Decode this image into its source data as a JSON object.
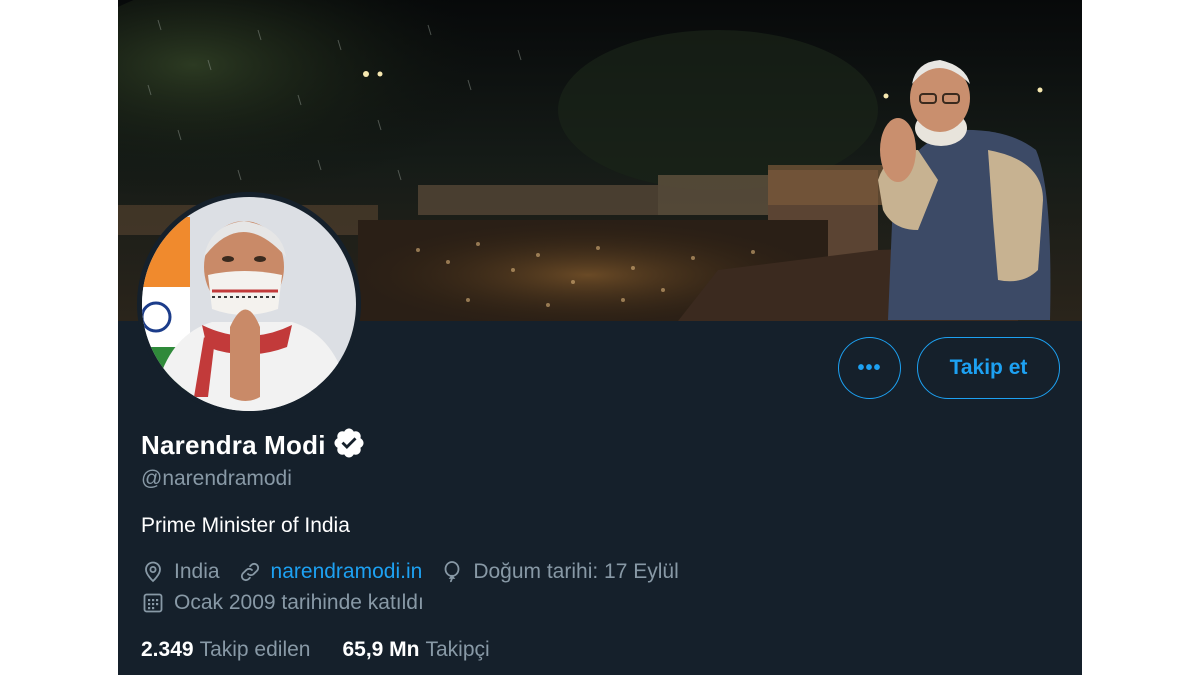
{
  "profile": {
    "display_name": "Narendra Modi",
    "handle": "@narendramodi",
    "bio": "Prime Minister of India",
    "verified": true,
    "location": "India",
    "website": "narendramodi.in",
    "birthday": "Doğum tarihi: 17 Eylül",
    "joined": "Ocak 2009 tarihinde katıldı"
  },
  "actions": {
    "more_label": "•••",
    "follow_label": "Takip et"
  },
  "stats": {
    "following_count": "2.349",
    "following_label": "Takip edilen",
    "followers_count": "65,9 Mn",
    "followers_label": "Takipçi"
  },
  "icons": {
    "verified": "verified-badge-icon",
    "location": "location-pin-icon",
    "website": "link-icon",
    "birthday": "balloon-icon",
    "joined": "calendar-icon",
    "more": "more-icon"
  },
  "colors": {
    "background": "#15202b",
    "accent": "#1da1f2",
    "secondary_text": "#8899a6",
    "primary_text": "#ffffff"
  }
}
